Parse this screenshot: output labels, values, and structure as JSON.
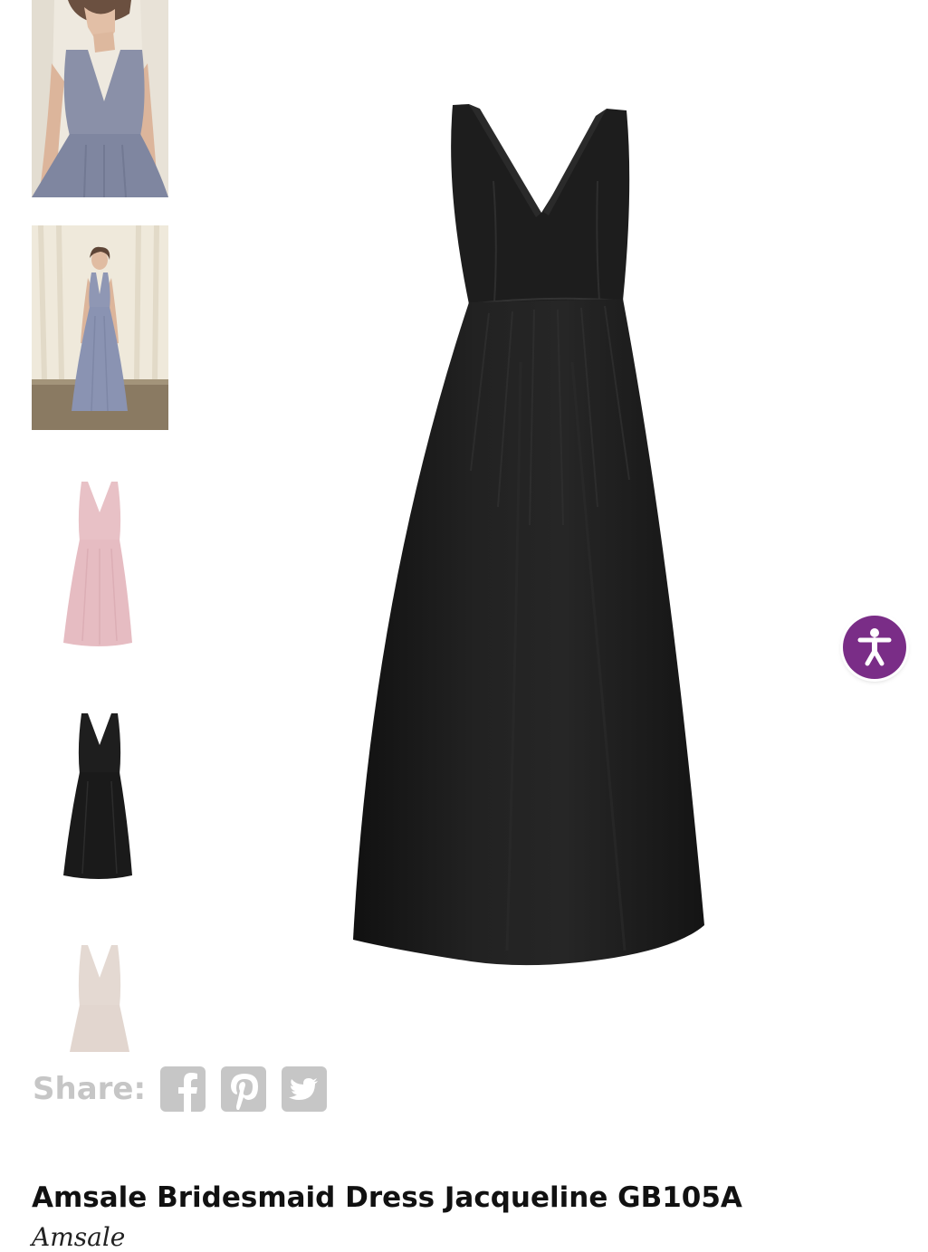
{
  "product": {
    "title": "Amsale Bridesmaid Dress Jacqueline GB105A",
    "brand": "Amsale"
  },
  "gallery": {
    "thumbnails": [
      {
        "name": "model-closeup",
        "color": "#8a90a8"
      },
      {
        "name": "model-full-length",
        "color": "#8f97b4"
      },
      {
        "name": "dress-pink",
        "color": "#e8c1c6"
      },
      {
        "name": "dress-black",
        "color": "#1c1c1c"
      },
      {
        "name": "dress-ivory",
        "color": "#e2d6cf"
      }
    ],
    "main_image": {
      "name": "dress-black-large",
      "color": "#1c1c1c"
    }
  },
  "share": {
    "label": "Share:",
    "icons": [
      "facebook-icon",
      "pinterest-icon",
      "twitter-icon"
    ],
    "icon_color": "#c6c6c6"
  },
  "accessibility": {
    "icon": "accessibility-icon",
    "color": "#7a2d87"
  }
}
